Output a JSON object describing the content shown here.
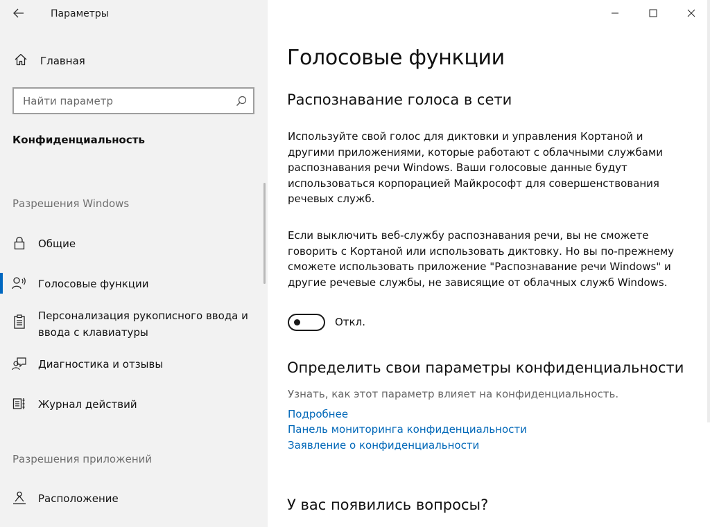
{
  "window": {
    "title": "Параметры"
  },
  "sidebar": {
    "home_label": "Главная",
    "search_placeholder": "Найти параметр",
    "category_title": "Конфиденциальность",
    "windows_permissions_label": "Разрешения Windows",
    "app_permissions_label": "Разрешения приложений",
    "items": [
      {
        "label": "Общие",
        "icon": "lock-icon"
      },
      {
        "label": "Голосовые функции",
        "icon": "speech-icon",
        "selected": true
      },
      {
        "label": "Персонализация рукописного ввода и ввода с клавиатуры",
        "icon": "clipboard-icon"
      },
      {
        "label": "Диагностика и отзывы",
        "icon": "feedback-icon"
      },
      {
        "label": "Журнал действий",
        "icon": "activity-history-icon"
      },
      {
        "label": "Расположение",
        "icon": "location-icon"
      }
    ]
  },
  "main": {
    "page_title": "Голосовые функции",
    "section1_title": "Распознавание голоса в сети",
    "para1": "Используйте свой голос для диктовки и управления Кортаной и другими приложениями, которые работают с облачными службами распознавания речи Windows. Ваши голосовые данные будут использоваться корпорацией Майкрософт для совершенствования речевых служб.",
    "para2": "Если выключить веб-службу распознавания речи, вы не сможете говорить с Кортаной или использовать диктовку. Но вы по-прежнему сможете использовать приложение \"Распознавание речи Windows\" и другие речевые службы, не зависящие от облачных служб Windows.",
    "toggle_state": "Откл.",
    "section2_title": "Определить свои параметры конфиденциальности",
    "section2_desc": "Узнать, как этот параметр влияет на конфиденциальность.",
    "links": [
      "Подробнее",
      "Панель мониторинга конфиденциальности",
      "Заявление о конфиденциальности"
    ],
    "section3_title": "У вас появились вопросы?"
  },
  "colors": {
    "accent": "#0067c0",
    "link": "#0067b8",
    "sidebar_bg": "#f2f2f2"
  }
}
